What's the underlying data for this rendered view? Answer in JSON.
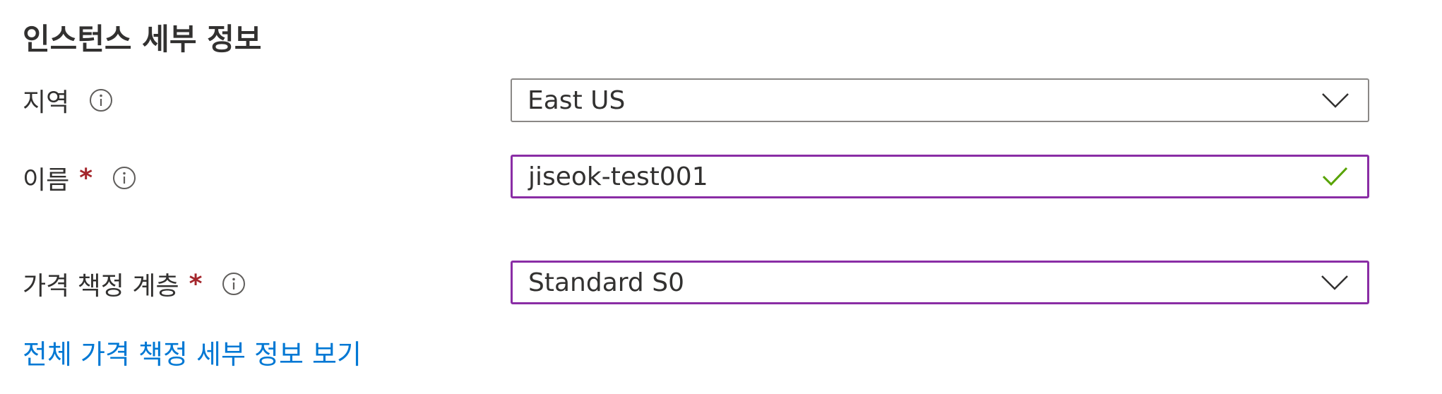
{
  "section": {
    "title": "인스턴스 세부 정보"
  },
  "region": {
    "label": "지역",
    "value": "East US",
    "info_icon": "info-icon",
    "dropdown_icon": "chevron-down-icon"
  },
  "name": {
    "label": "이름",
    "required_mark": "*",
    "value": "jiseok-test001",
    "info_icon": "info-icon",
    "status_icon": "checkmark-icon"
  },
  "pricing_tier": {
    "label": "가격 책정 계층",
    "required_mark": "*",
    "value": "Standard S0",
    "info_icon": "info-icon",
    "dropdown_icon": "chevron-down-icon"
  },
  "pricing_link": {
    "label": "전체 가격 책정 세부 정보 보기"
  },
  "colors": {
    "text": "#323130",
    "required": "#a4262c",
    "focus_border": "#8a2da5",
    "link": "#0078d4",
    "valid_check": "#57a300",
    "border": "#8a8886"
  }
}
